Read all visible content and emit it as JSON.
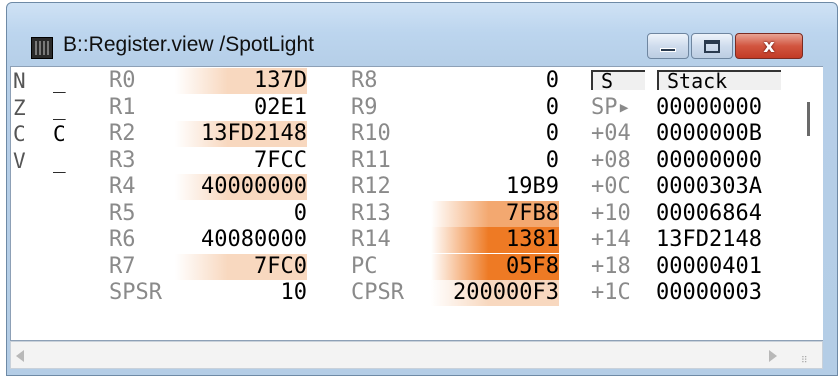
{
  "window": {
    "title": "B::Register.view /SpotLight",
    "close_glyph": "x",
    "app_icon": "chip-icon"
  },
  "colors": {
    "spot_light": "#f8d8bf",
    "spot_mid": "#f3a870",
    "spot_strong": "#ee7a24",
    "title_bg": "#bcd5ee",
    "close_red": "#c7412b"
  },
  "flags": [
    {
      "name": "N",
      "value": "_"
    },
    {
      "name": "Z",
      "value": "_"
    },
    {
      "name": "C",
      "value": "C"
    },
    {
      "name": "V",
      "value": "_"
    }
  ],
  "registers_left": [
    {
      "name": "R0",
      "value": "137D",
      "spot": "light"
    },
    {
      "name": "R1",
      "value": "02E1",
      "spot": "none"
    },
    {
      "name": "R2",
      "value": "13FD2148",
      "spot": "light"
    },
    {
      "name": "R3",
      "value": "7FCC",
      "spot": "none"
    },
    {
      "name": "R4",
      "value": "40000000",
      "spot": "light"
    },
    {
      "name": "R5",
      "value": "0",
      "spot": "none"
    },
    {
      "name": "R6",
      "value": "40080000",
      "spot": "none"
    },
    {
      "name": "R7",
      "value": "7FC0",
      "spot": "light"
    },
    {
      "name": "SPSR",
      "value": "10",
      "spot": "none"
    }
  ],
  "registers_right": [
    {
      "name": "R8",
      "value": "0",
      "spot": "none"
    },
    {
      "name": "R9",
      "value": "0",
      "spot": "none"
    },
    {
      "name": "R10",
      "value": "0",
      "spot": "none"
    },
    {
      "name": "R11",
      "value": "0",
      "spot": "none"
    },
    {
      "name": "R12",
      "value": "19B9",
      "spot": "none"
    },
    {
      "name": "R13",
      "value": "7FB8",
      "spot": "mid"
    },
    {
      "name": "R14",
      "value": "1381",
      "spot": "strong"
    },
    {
      "name": "PC",
      "value": "05F8",
      "spot": "strong"
    },
    {
      "name": "CPSR",
      "value": "200000F3",
      "spot": "light"
    }
  ],
  "stack": {
    "col_s_label": "S",
    "col_stack_label": "Stack",
    "rows": [
      {
        "offset": "SP▸",
        "value": "00000000"
      },
      {
        "offset": "+04",
        "value": "0000000B"
      },
      {
        "offset": "+08",
        "value": "00000000"
      },
      {
        "offset": "+0C",
        "value": "0000303A"
      },
      {
        "offset": "+10",
        "value": "00006864"
      },
      {
        "offset": "+14",
        "value": "13FD2148"
      },
      {
        "offset": "+18",
        "value": "00000401"
      },
      {
        "offset": "+1C",
        "value": "00000003"
      }
    ]
  }
}
